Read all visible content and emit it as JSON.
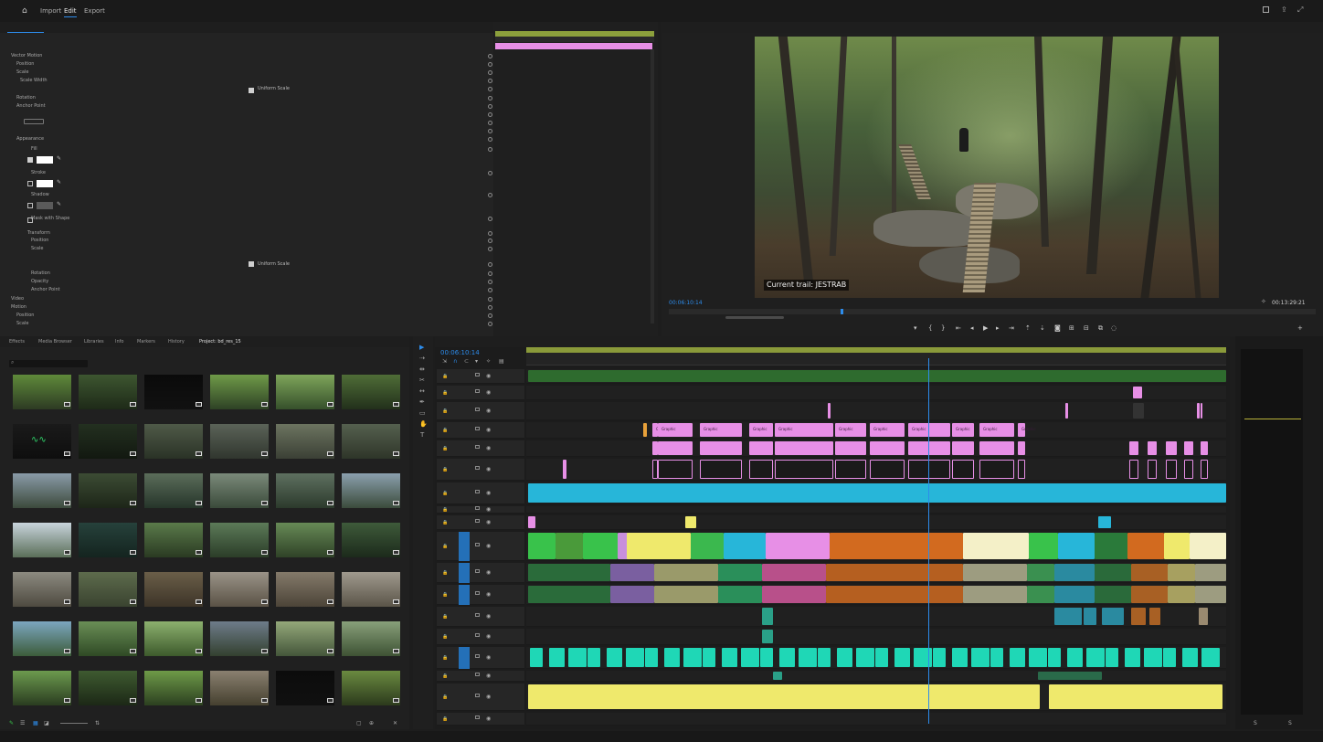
{
  "app": {
    "workspaces": [
      "Import",
      "Edit",
      "Export"
    ],
    "active_workspace": "Edit",
    "title": "",
    "status_text": "",
    "status_right": ""
  },
  "source_panel": {
    "tabs": [],
    "active_tab": "",
    "ec_header_left": "",
    "ec_header_right": "",
    "section_video": "",
    "rows": [
      {
        "label": "Vector Motion",
        "x": "",
        "y": ""
      },
      {
        "label": "Position",
        "x": "",
        "y": ""
      },
      {
        "label": "Scale",
        "x": "",
        "y": ""
      },
      {
        "label": "Scale Width",
        "x": "",
        "y": ""
      },
      {
        "label": "",
        "x": "Uniform Scale",
        "y": ""
      },
      {
        "label": "Rotation",
        "x": "",
        "y": ""
      },
      {
        "label": "Anchor Point",
        "x": "",
        "y": ""
      },
      {
        "label": "",
        "x": "",
        "y": ""
      },
      {
        "label": "",
        "x": "",
        "y": ""
      },
      {
        "label": "",
        "x": "",
        "y": ""
      },
      {
        "label": "Appearance",
        "x": "",
        "y": ""
      },
      {
        "label": "Fill",
        "x": "",
        "y": ""
      },
      {
        "label": "Stroke",
        "x": "",
        "y": ""
      },
      {
        "label": "Shadow",
        "x": "",
        "y": ""
      },
      {
        "label": "Mask with Shape",
        "x": "",
        "y": ""
      },
      {
        "label": "Transform",
        "x": "",
        "y": ""
      },
      {
        "label": "Position",
        "x": "",
        "y": ""
      },
      {
        "label": "Scale",
        "x": "",
        "y": ""
      },
      {
        "label": "",
        "x": "Uniform Scale",
        "y": ""
      },
      {
        "label": "Rotation",
        "x": "",
        "y": ""
      },
      {
        "label": "Opacity",
        "x": "",
        "y": ""
      },
      {
        "label": "Anchor Point",
        "x": "",
        "y": ""
      },
      {
        "label": "Video",
        "x": "",
        "y": ""
      },
      {
        "label": "Motion",
        "x": "",
        "y": ""
      },
      {
        "label": "Position",
        "x": "",
        "y": ""
      },
      {
        "label": "Scale",
        "x": "",
        "y": ""
      }
    ],
    "timecode": "",
    "mini_clip_label": ""
  },
  "program_monitor": {
    "tab": "",
    "timecode": "00:06:10:14",
    "fit": "",
    "quality": "",
    "duration": "00:13:29:21",
    "caption_text": "Current trail: JESTRAB"
  },
  "project_panel": {
    "tabs": [
      "Effects",
      "Media Browser",
      "Libraries",
      "Info",
      "Markers",
      "History",
      "Project: bd_res_15"
    ],
    "active_tab": "Project: bd_res_15",
    "bin_path": "",
    "item_count": "",
    "items": [
      {
        "name": "",
        "dur": ""
      },
      {
        "name": "",
        "dur": ""
      },
      {
        "name": "",
        "dur": ""
      },
      {
        "name": "",
        "dur": ""
      },
      {
        "name": "",
        "dur": ""
      },
      {
        "name": "",
        "dur": ""
      },
      {
        "name": "",
        "dur": ""
      },
      {
        "name": "",
        "dur": ""
      },
      {
        "name": "",
        "dur": ""
      },
      {
        "name": "",
        "dur": ""
      },
      {
        "name": "",
        "dur": ""
      },
      {
        "name": "",
        "dur": ""
      },
      {
        "name": "",
        "dur": ""
      },
      {
        "name": "",
        "dur": ""
      },
      {
        "name": "",
        "dur": ""
      },
      {
        "name": "",
        "dur": ""
      },
      {
        "name": "",
        "dur": ""
      },
      {
        "name": "",
        "dur": ""
      },
      {
        "name": "",
        "dur": ""
      },
      {
        "name": "",
        "dur": ""
      },
      {
        "name": "",
        "dur": ""
      },
      {
        "name": "",
        "dur": ""
      },
      {
        "name": "",
        "dur": ""
      },
      {
        "name": "",
        "dur": ""
      },
      {
        "name": "",
        "dur": ""
      },
      {
        "name": "",
        "dur": ""
      },
      {
        "name": "",
        "dur": ""
      },
      {
        "name": "",
        "dur": ""
      },
      {
        "name": "",
        "dur": ""
      },
      {
        "name": "",
        "dur": ""
      },
      {
        "name": "",
        "dur": ""
      },
      {
        "name": "",
        "dur": ""
      },
      {
        "name": "",
        "dur": ""
      },
      {
        "name": "",
        "dur": ""
      },
      {
        "name": "",
        "dur": ""
      },
      {
        "name": "",
        "dur": ""
      },
      {
        "name": "",
        "dur": ""
      },
      {
        "name": "",
        "dur": ""
      },
      {
        "name": "",
        "dur": ""
      },
      {
        "name": "",
        "dur": ""
      },
      {
        "name": "",
        "dur": ""
      },
      {
        "name": "",
        "dur": ""
      }
    ]
  },
  "timeline": {
    "tab": "",
    "timecode": "00:06:10:14",
    "ruler_ticks": [],
    "tracks": [
      {
        "id": "",
        "name": ""
      },
      {
        "id": "",
        "name": ""
      },
      {
        "id": "",
        "name": ""
      },
      {
        "id": "",
        "name": ""
      },
      {
        "id": "",
        "name": ""
      },
      {
        "id": "",
        "name": ""
      },
      {
        "id": "",
        "name": ""
      },
      {
        "id": "",
        "name": ""
      },
      {
        "id": "",
        "name": ""
      },
      {
        "id": "",
        "name": ""
      },
      {
        "id": "",
        "name": ""
      },
      {
        "id": "",
        "name": ""
      },
      {
        "id": "",
        "name": ""
      },
      {
        "id": "",
        "name": ""
      },
      {
        "id": "",
        "name": ""
      },
      {
        "id": "",
        "name": ""
      },
      {
        "id": "",
        "name": ""
      },
      {
        "id": "",
        "name": ""
      }
    ],
    "mix_label": "",
    "mix_value": "",
    "graphic_label": "Graphic"
  },
  "audio_meter": {
    "scale": []
  },
  "colors": {
    "accent": "#2d8ceb",
    "pink": "#e78fe6",
    "cyan": "#27b6d9",
    "teal": "#1fd7b6",
    "green": "#39c24b",
    "yellow": "#efe96c",
    "orange": "#d26a1f",
    "cream": "#f4f0c8",
    "olive": "#8a9a3a"
  }
}
